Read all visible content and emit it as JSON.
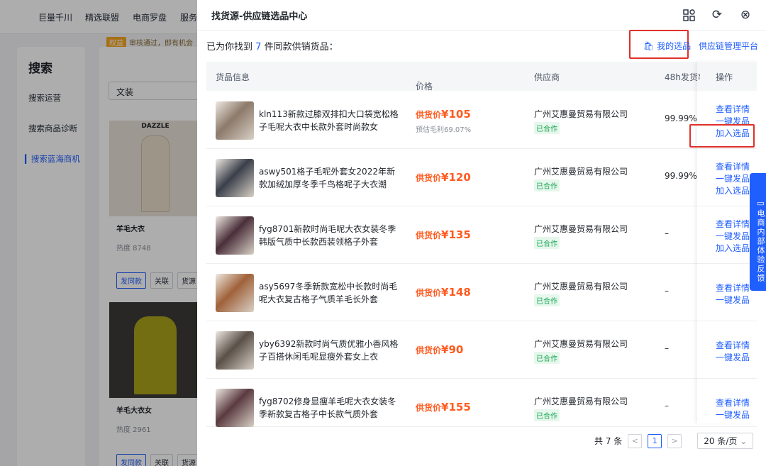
{
  "background": {
    "nav": [
      "巨量千川",
      "精选联盟",
      "电商罗盘",
      "服务"
    ],
    "notice_tag": "权益",
    "notice_text": "审核通过，即有机会",
    "left_title": "搜索",
    "left_items": [
      "搜索运营",
      "搜索商品诊断",
      "搜索蓝海商机"
    ],
    "search_value": "文装",
    "cards": [
      {
        "brand": "DAZZLE",
        "title": "羊毛大衣",
        "heat": "热度 8748"
      },
      {
        "brand": "",
        "title": "羊毛大衣女",
        "heat": "热度 2961"
      }
    ],
    "card_buttons": [
      "发同款",
      "关联",
      "货源"
    ]
  },
  "drawer": {
    "title": "找货源-供应链选品中心",
    "found_prefix": "已为你找到",
    "found_count": "7",
    "found_suffix": "件同款供销货品：",
    "my_selection": "我的选品",
    "scm_link": "供应链管理平台",
    "columns": [
      "货品信息",
      "价格",
      "供应商",
      "48h发货率",
      "操作"
    ],
    "rows": [
      {
        "name": "kln113新款过膝双排扣大口袋宽松格子毛呢大衣中长款外套时尚款女",
        "price_label": "供货价",
        "price": "¥105",
        "margin": "预估毛利69.07%",
        "supplier": "广州艾惠曼贸易有限公司",
        "status": "已合作",
        "rate": "99.99%",
        "ops": [
          "查看详情",
          "一键发品",
          "加入选品"
        ],
        "color": "#8c7a6a"
      },
      {
        "name": "aswy501格子毛呢外套女2022年新款加绒加厚冬季千鸟格呢子大衣潮",
        "price_label": "供货价",
        "price": "¥120",
        "margin": "",
        "supplier": "广州艾惠曼贸易有限公司",
        "status": "已合作",
        "rate": "99.99%",
        "ops": [
          "查看详情",
          "一键发品",
          "加入选品"
        ],
        "color": "#3a3f4a"
      },
      {
        "name": "fyg8701新款时尚毛呢大衣女装冬季韩版气质中长款西装领格子外套",
        "price_label": "供货价",
        "price": "¥135",
        "margin": "",
        "supplier": "广州艾惠曼贸易有限公司",
        "status": "已合作",
        "rate": "–",
        "ops": [
          "查看详情",
          "一键发品",
          "加入选品"
        ],
        "color": "#4a2f3a"
      },
      {
        "name": "asy5697冬季新款宽松中长款时尚毛呢大衣复古格子气质羊毛长外套",
        "price_label": "供货价",
        "price": "¥148",
        "margin": "",
        "supplier": "广州艾惠曼贸易有限公司",
        "status": "已合作",
        "rate": "–",
        "ops": [
          "查看详情",
          "一键发品"
        ],
        "color": "#a0623a"
      },
      {
        "name": "yby6392新款时尚气质优雅小香风格子百搭休闲毛呢显瘦外套女上衣",
        "price_label": "供货价",
        "price": "¥90",
        "margin": "",
        "supplier": "广州艾惠曼贸易有限公司",
        "status": "已合作",
        "rate": "–",
        "ops": [
          "查看详情",
          "一键发品"
        ],
        "color": "#5a5048"
      },
      {
        "name": "fyg8702修身显瘦羊毛呢大衣女装冬季新款复古格子中长款气质外套",
        "price_label": "供货价",
        "price": "¥155",
        "margin": "",
        "supplier": "广州艾惠曼贸易有限公司",
        "status": "已合作",
        "rate": "–",
        "ops": [
          "查看详情",
          "一键发品"
        ],
        "color": "#5a3a40"
      }
    ],
    "pager": {
      "total": "共 7 条",
      "prev": "<",
      "page": "1",
      "next": ">",
      "size": "20 条/页"
    }
  },
  "feedback": "电商内部体验反馈"
}
